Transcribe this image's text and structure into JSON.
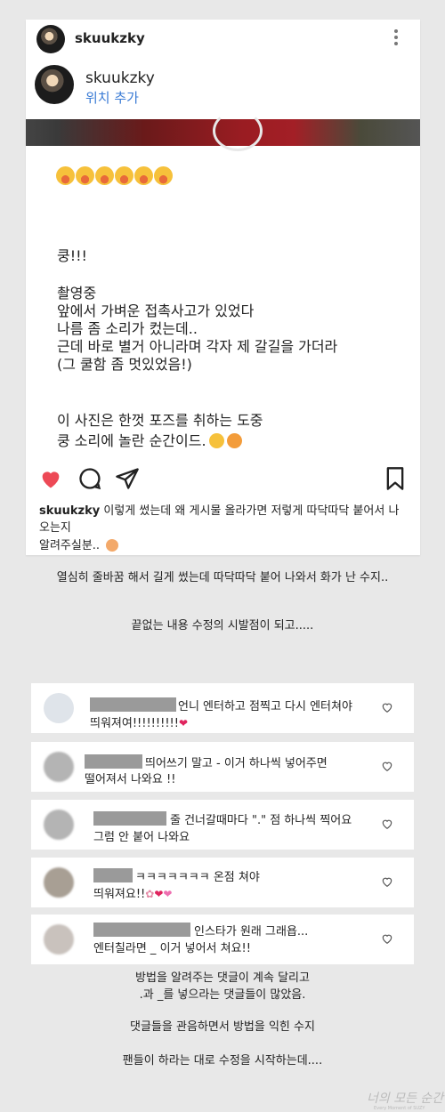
{
  "post": {
    "username": "skuukzky",
    "location": "위치 추가",
    "lines": [
      "쿵!!!",
      "촬영중",
      "앞에서 가벼운 접촉사고가 있었다",
      "나름 좀 소리가 컸는데..",
      "근데 바로 별거 아니라며 각자 제 갈길을 가더라",
      "(그 쿨함 좀 멋있었음!)",
      "이 사진은 한껏 포즈를 취하는 도중",
      "쿵 소리에 놀란 순간이드."
    ],
    "caption_user": "skuukzky",
    "caption_text": " 이렇게 썼는데 왜 게시물 올라가면 저렇게 따닥따닥 붙어서 나오는지",
    "caption_line2": "알려주실분.. ",
    "heart_color": "#ed4956"
  },
  "narration": {
    "n1": "열심히 줄바꿈 해서 길게 썼는데 따닥따닥 붙어 나와서 화가 난 수지..",
    "n2": "끝없는 내용 수정의 시발점이 되고.....",
    "n3": "방법을 알려주는 댓글이 계속 달리고",
    "n4": ".과 _를 넣으라는 댓글들이 많았음.",
    "n5": "댓글들을 관음하면서 방법을 익힌 수지",
    "n6": "팬들이 하라는 대로 수정을 시작하는데...."
  },
  "comments": [
    {
      "line1": "언니 엔터하고 점찍고 다시 엔터쳐야",
      "line2": "띄워져여!!!!!!!!!!"
    },
    {
      "line1": "띄어쓰기 말고 - 이거 하나씩 넣어주면",
      "line2": "떨어져서 나와요 !!"
    },
    {
      "line1": "줄 건너갈때마다 \".\" 점 하나씩 찍어요",
      "line2": "그럼 안 붙어 나와요"
    },
    {
      "line1": "ㅋㅋㅋㅋㅋㅋㅋ 온점 쳐야",
      "line2": "띄워져요!!"
    },
    {
      "line1": "인스타가 원래 그래욥...",
      "line2": "엔터칠라면 _ 이거 넣어서 쳐요!!"
    }
  ],
  "watermark": {
    "main": "너의 모든 순간",
    "sub": "Every Moment of SUZY"
  }
}
